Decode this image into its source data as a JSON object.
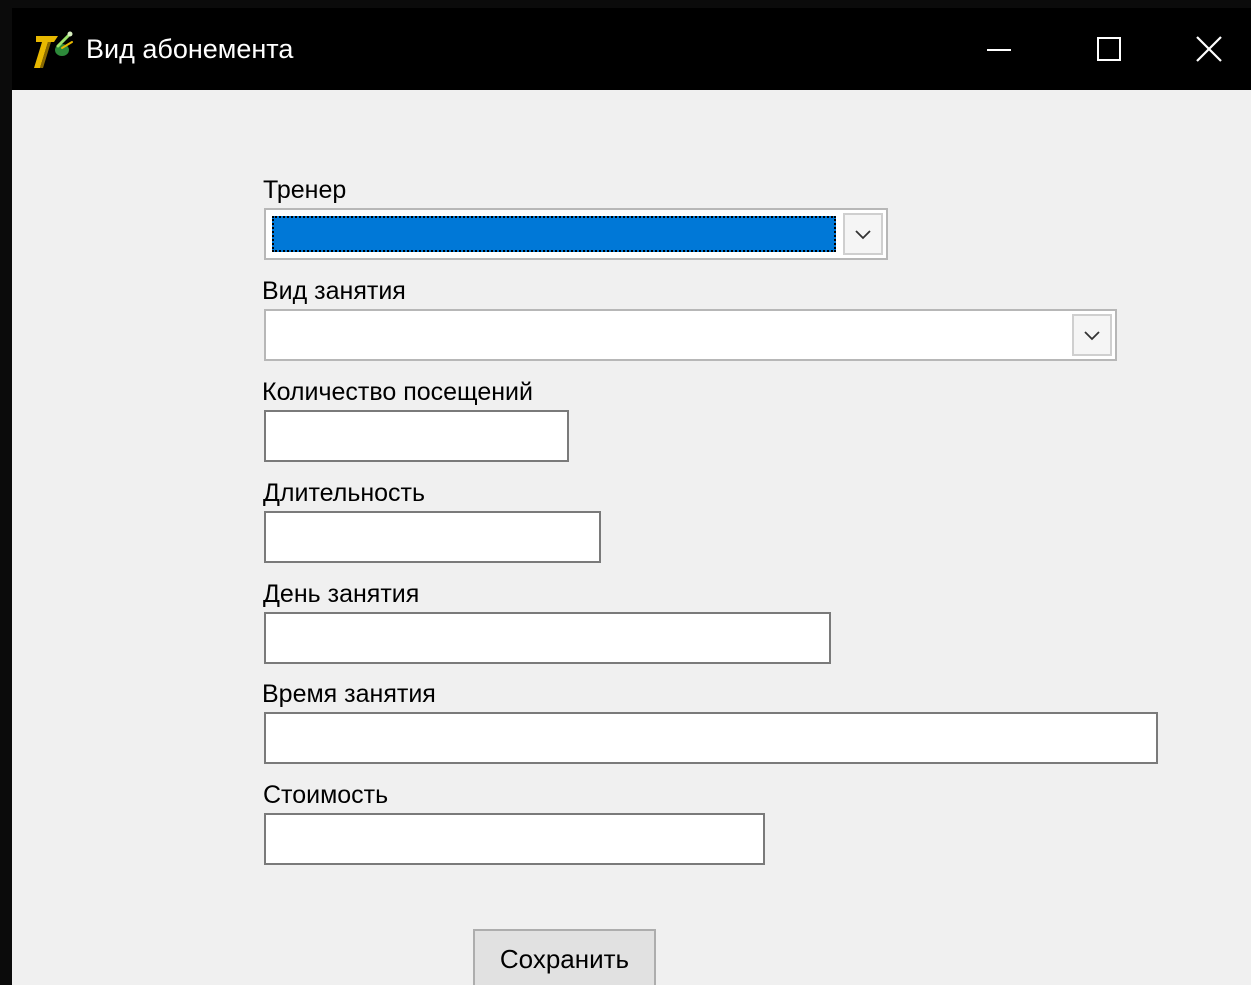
{
  "window": {
    "title": "Вид абонемента",
    "app_icon": "app-logo-icon",
    "controls": {
      "minimize_icon": "minimize-icon",
      "maximize_icon": "maximize-icon",
      "close_icon": "close-icon"
    }
  },
  "form": {
    "trainer": {
      "label": "Тренер",
      "value": ""
    },
    "activity_type": {
      "label": "Вид занятия",
      "value": ""
    },
    "visits_count": {
      "label": "Количество посещений",
      "value": ""
    },
    "duration": {
      "label": "Длительность",
      "value": ""
    },
    "day": {
      "label": "День занятия",
      "value": ""
    },
    "time": {
      "label": "Время занятия",
      "value": ""
    },
    "cost": {
      "label": "Стоимость",
      "value": ""
    }
  },
  "buttons": {
    "save_label": "Сохранить"
  },
  "colors": {
    "titlebar_bg": "#000000",
    "window_bg": "#f0f0f0",
    "selection_highlight": "#0078d7"
  }
}
